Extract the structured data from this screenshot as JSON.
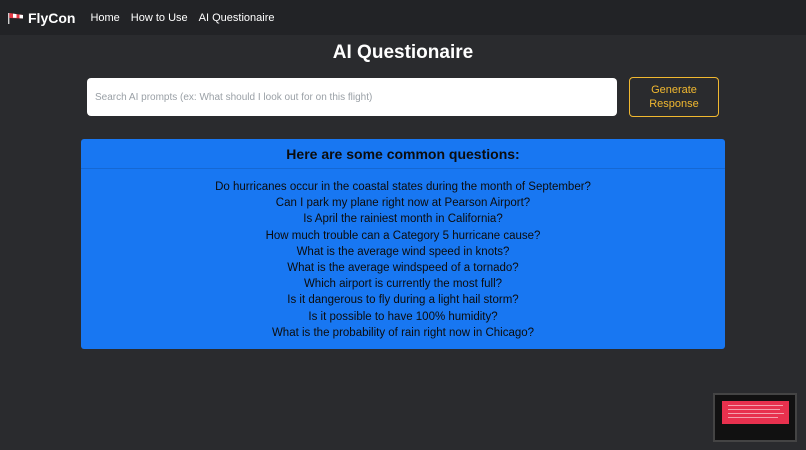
{
  "navbar": {
    "brand": "FlyCon",
    "brand_icon": "windsock-icon",
    "links": [
      "Home",
      "How to Use",
      "AI Questionaire"
    ]
  },
  "page": {
    "title": "AI Questionaire"
  },
  "search": {
    "placeholder": "Search AI prompts (ex: What should I look out for on this flight)",
    "value": ""
  },
  "generate_button": {
    "label": "Generate Response"
  },
  "questions": {
    "header": "Here are some common questions:",
    "items": [
      "Do hurricanes occur in the coastal states during the month of September?",
      "Can I park my plane right now at Pearson Airport?",
      "Is April the rainiest month in California?",
      "How much trouble can a Category 5 hurricane cause?",
      "What is the average wind speed in knots?",
      "What is the average windspeed of a tornado?",
      "Which airport is currently the most full?",
      "Is it dangerous to fly during a light hail storm?",
      "Is it possible to have 100% humidity?",
      "What is the probability of rain right now in Chicago?"
    ]
  },
  "colors": {
    "background": "#2a2b2e",
    "navbar": "#222326",
    "card": "#1877f2",
    "button_accent": "#f1b830"
  }
}
